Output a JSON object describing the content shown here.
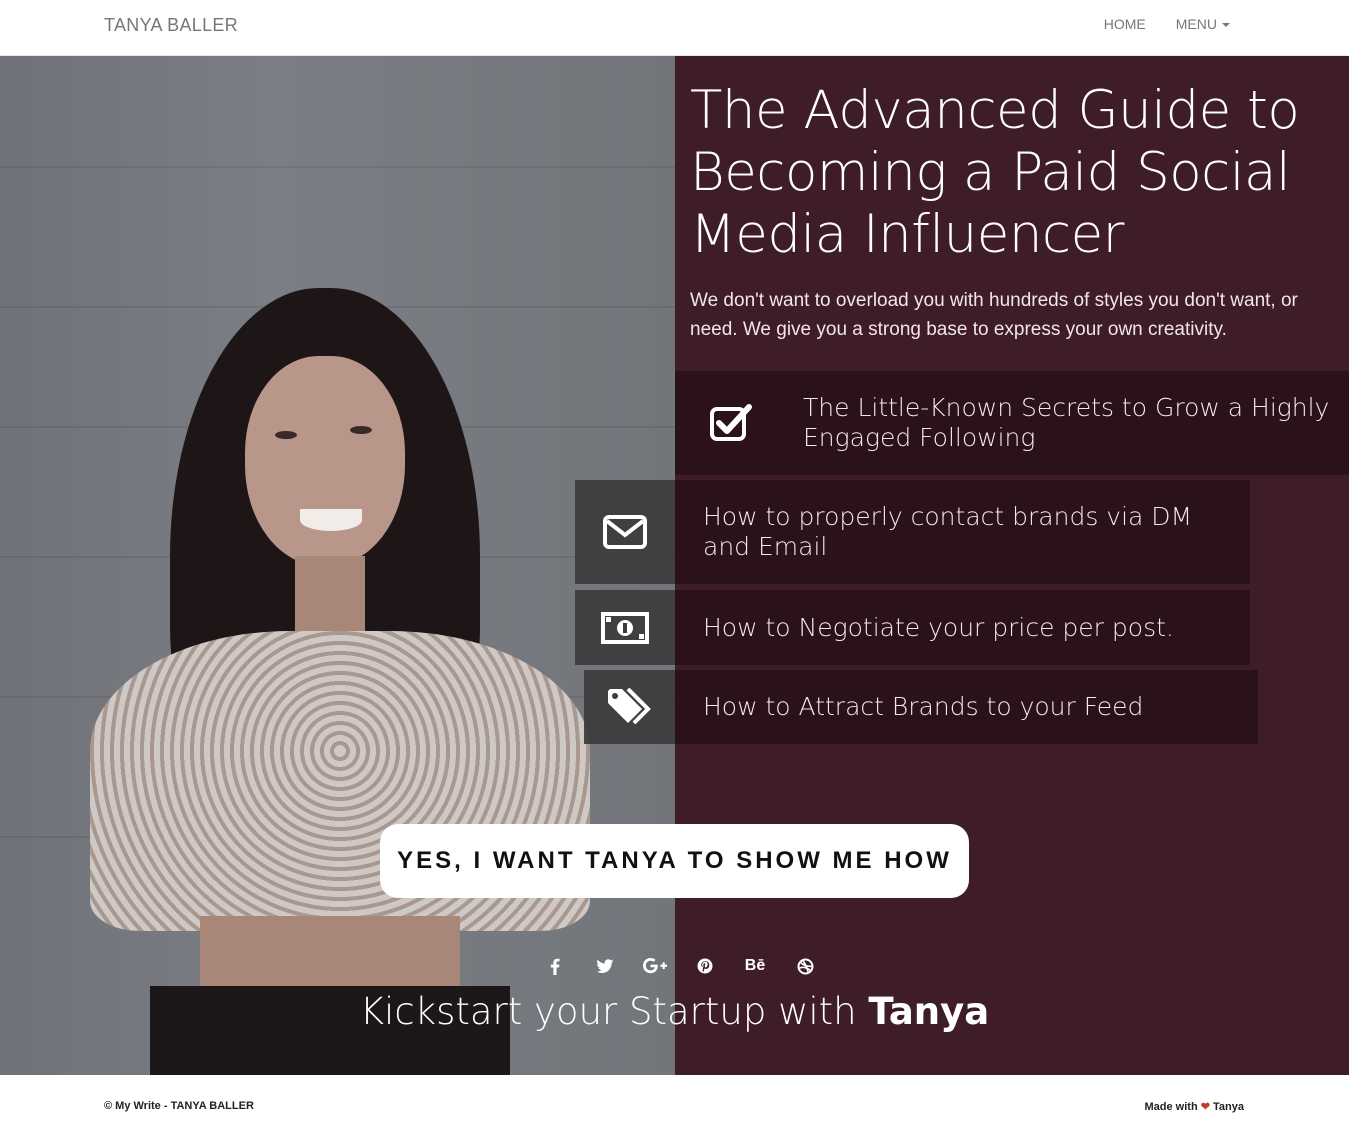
{
  "nav": {
    "brand": "TANYA BALLER",
    "home": "HOME",
    "menu": "MENU"
  },
  "hero": {
    "headline": "The Advanced Guide to Becoming a Paid Social Media Influencer",
    "subtext": "We don't want to overload you with hundreds of styles you don't want, or need. We give you a strong base to express your own creativity.",
    "features": [
      {
        "icon": "check-square-icon",
        "text": "The Little-Known Secrets to Grow a Highly Engaged Following"
      },
      {
        "icon": "envelope-icon",
        "text": "How to properly contact brands via DM and Email"
      },
      {
        "icon": "money-bill-icon",
        "text": "How to Negotiate your price per post."
      },
      {
        "icon": "tags-icon",
        "text": "How to Attract Brands to your Feed"
      }
    ],
    "cta": "YES, I WANT TANYA TO SHOW ME HOW",
    "social": [
      "facebook-icon",
      "twitter-icon",
      "google-plus-icon",
      "pinterest-icon",
      "behance-icon",
      "dribbble-icon"
    ],
    "social_glyphs": {
      "behance": "Bē"
    },
    "kickstart_prefix": "Kickstart your Startup with",
    "kickstart_name": "Tanya"
  },
  "footer": {
    "copyright": "© My Write - TANYA BALLER",
    "made_with": "Made with",
    "made_by": "Tanya"
  },
  "colors": {
    "panel": "#3e1c28",
    "feature_text_bg": "#2a111a",
    "feature_icon_bg": "#3c3c3e",
    "heart": "#c0392b"
  }
}
